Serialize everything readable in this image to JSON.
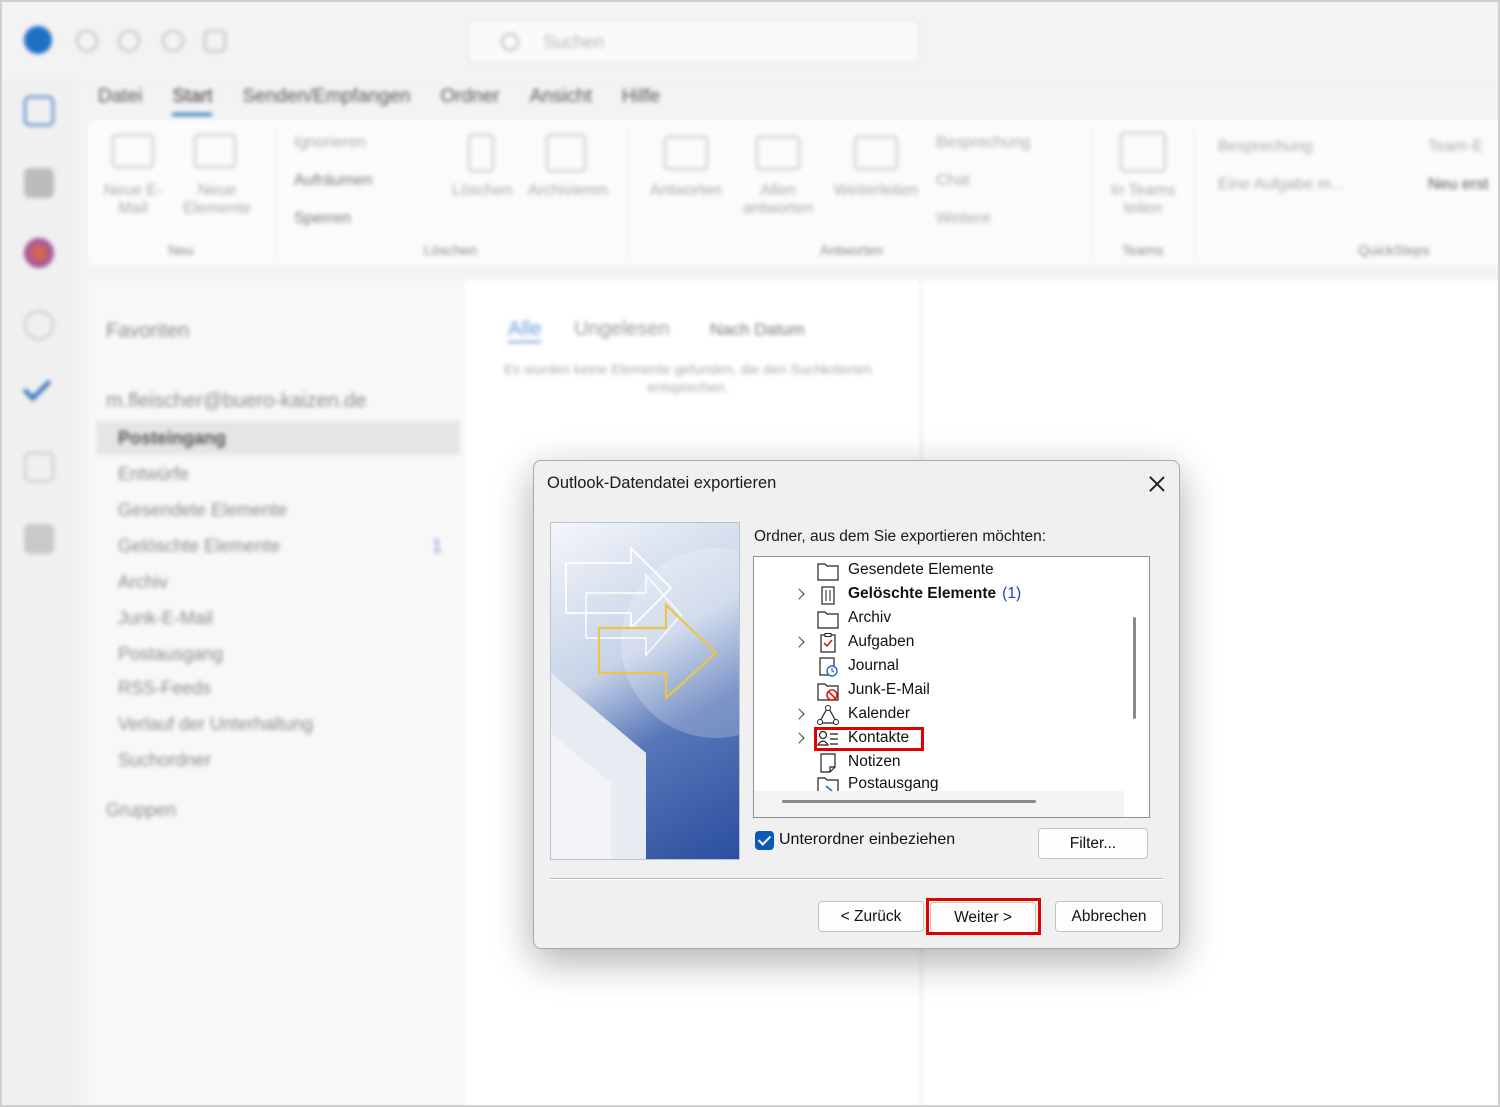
{
  "background": {
    "search": {
      "placeholder": "Suchen"
    },
    "menu_tabs": [
      "Datei",
      "Start",
      "Senden/Empfangen",
      "Ordner",
      "Ansicht",
      "Hilfe"
    ],
    "ribbon": {
      "new_mail": "Neue E-Mail",
      "new_items": "Neue Elemente",
      "group_new": "Neu",
      "ignore": "Ignorieren",
      "cleanup": "Aufräumen",
      "junk": "Sperren",
      "delete": "Löschen",
      "archive": "Archivieren",
      "group_delete": "Löschen",
      "reply": "Antworten",
      "reply_all": "Allen antworten",
      "forward": "Weiterleiten",
      "meeting": "Besprechung",
      "chat": "Chat",
      "more": "Weitere",
      "group_respond": "Antworten",
      "teams_share": "In Teams teilen",
      "group_teams": "Teams",
      "qs_meeting": "Besprechung",
      "qs_task": "Eine Aufgabe m...",
      "qs_new": "Neu erst",
      "qs_team": "Team-E",
      "group_quicksteps": "QuickSteps"
    },
    "folder_pane": {
      "favorites": "Favoriten",
      "account": "m.fleischer@buero-kaizen.de",
      "folders": [
        "Posteingang",
        "Entwürfe",
        "Gesendete Elemente",
        "Gelöschte Elemente",
        "Archiv",
        "Junk-E-Mail",
        "Postausgang",
        "RSS-Feeds",
        "Verlauf der Unterhaltung",
        "Suchordner"
      ],
      "deleted_count": "1",
      "groups": "Gruppen"
    },
    "list_pane": {
      "tab_all": "Alle",
      "tab_unread": "Ungelesen",
      "sort": "Nach Datum",
      "empty_message": "Es wurden keine Elemente gefunden, die den Suchkriterien entsprechen."
    }
  },
  "dialog": {
    "title": "Outlook-Datendatei exportieren",
    "prompt": "Ordner, aus dem Sie exportieren möchten:",
    "folders": [
      {
        "label": "Gesendete Elemente",
        "expandable": false,
        "icon": "folder-icon"
      },
      {
        "label": "Gelöschte Elemente",
        "expandable": true,
        "bold": true,
        "count": "(1)",
        "icon": "trash-icon"
      },
      {
        "label": "Archiv",
        "expandable": false,
        "icon": "folder-icon"
      },
      {
        "label": "Aufgaben",
        "expandable": true,
        "icon": "task-icon"
      },
      {
        "label": "Journal",
        "expandable": false,
        "icon": "journal-icon"
      },
      {
        "label": "Junk-E-Mail",
        "expandable": false,
        "icon": "junk-icon"
      },
      {
        "label": "Kalender",
        "expandable": true,
        "icon": "calendar-icon"
      },
      {
        "label": "Kontakte",
        "expandable": true,
        "selected": true,
        "icon": "contacts-icon"
      },
      {
        "label": "Notizen",
        "expandable": false,
        "icon": "notes-icon"
      },
      {
        "label": "Postausgang",
        "expandable": false,
        "icon": "outbox-icon"
      }
    ],
    "include_subfolders": "Unterordner einbeziehen",
    "include_subfolders_checked": true,
    "filter_button": "Filter...",
    "back_button": "< Zurück",
    "next_button": "Weiter >",
    "cancel_button": "Abbrechen",
    "highlight_color": "#e00000",
    "accent_color": "#0a5bb5"
  }
}
